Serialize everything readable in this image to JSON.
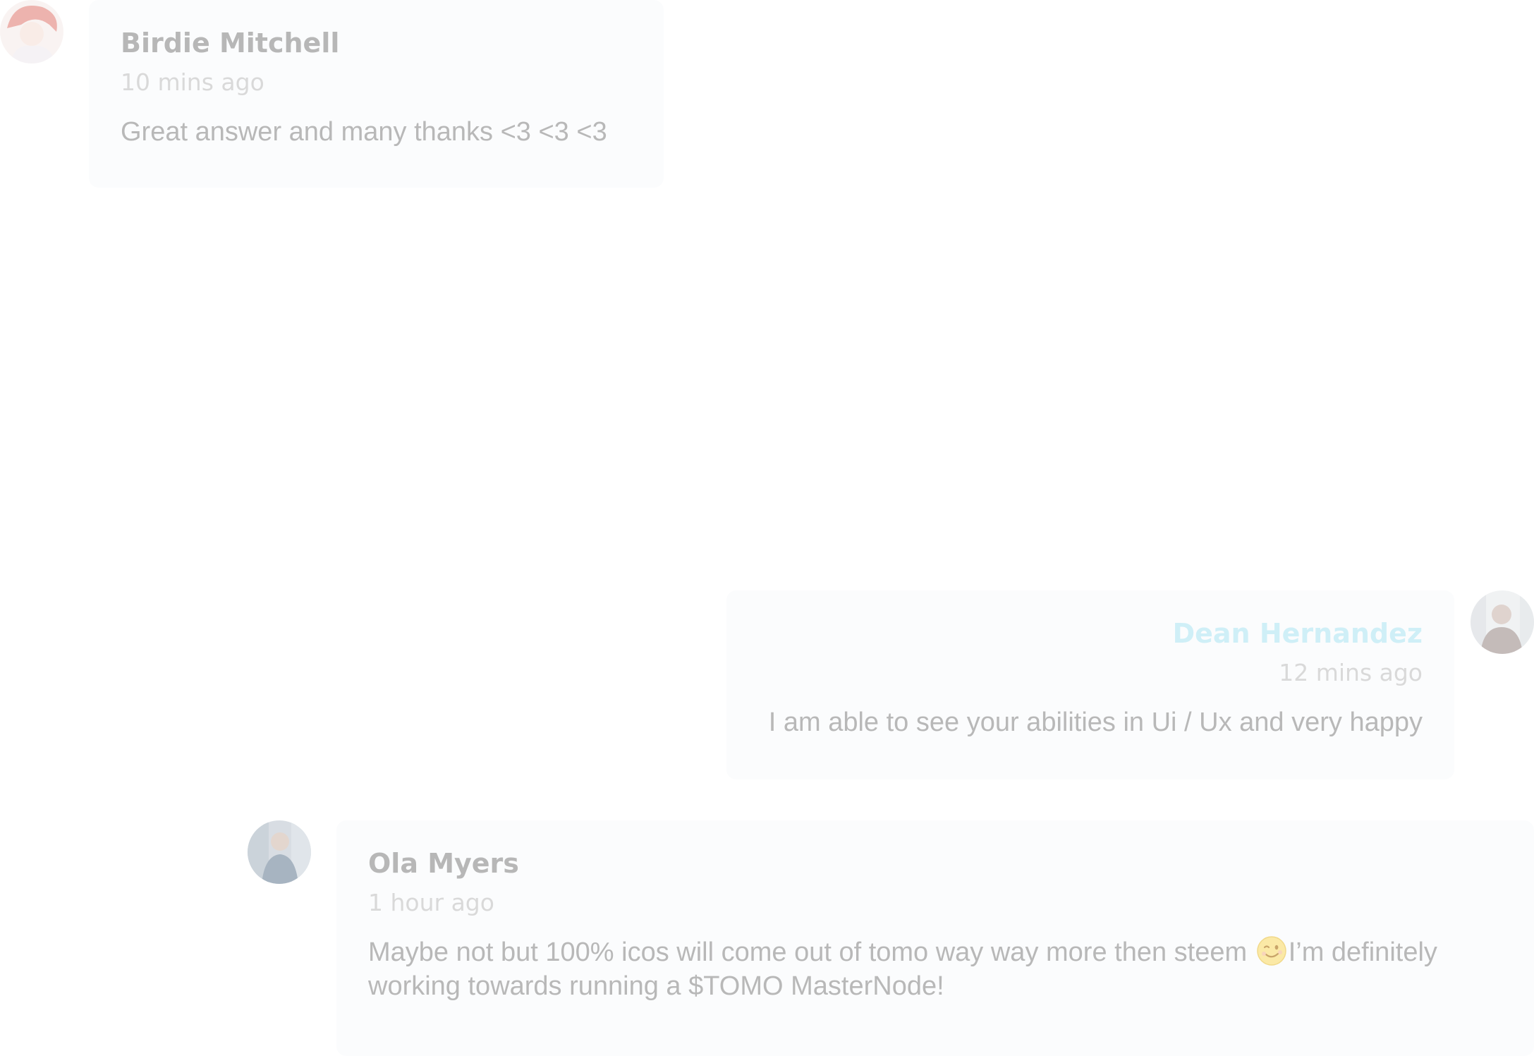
{
  "comments": [
    {
      "author": "Birdie Mitchell",
      "time": "10 mins ago",
      "text": "Great answer and many thanks <3 <3 <3"
    },
    {
      "author": "Dean Hernandez",
      "time": "12 mins ago",
      "text": "I am able to see your abilities in Ui / Ux and very happy"
    },
    {
      "author": "Ola Myers",
      "time": "1 hour ago",
      "text_before_emoji": "Maybe not but 100% icos will come out of tomo way way more then steem ",
      "emoji": "winking-face-emoji",
      "text_after_emoji": "I’m definitely working towards running a $TOMO MasterNode!"
    }
  ],
  "colors": {
    "author_default": "#b7b7b7",
    "author_highlight": "#cfeff7",
    "timestamp": "#d9d9d9",
    "message": "#b8b8b8",
    "bubble_bg": "#fbfcfd"
  }
}
